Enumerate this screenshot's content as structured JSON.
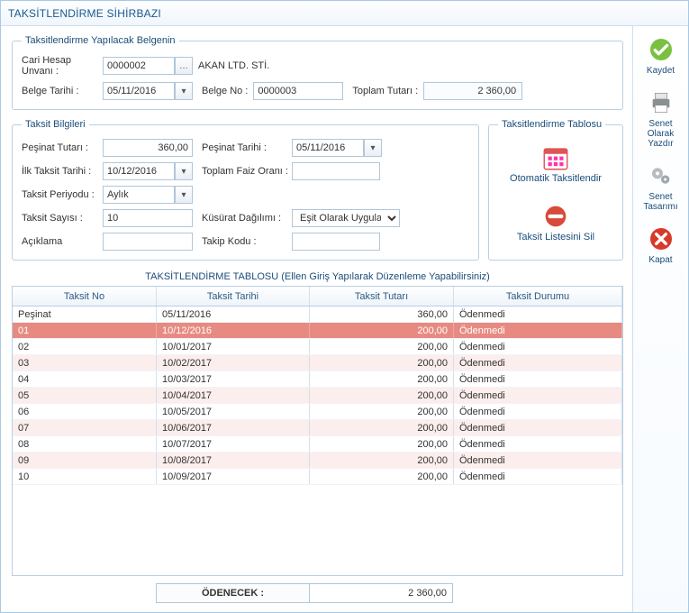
{
  "window_title": "TAKSİTLENDİRME SİHİRBAZI",
  "doc": {
    "legend": "Taksitlendirme Yapılacak Belgenin",
    "cari_label": "Cari Hesap Unvanı :",
    "cari_value": "0000002",
    "cari_name": "AKAN LTD. STİ.",
    "belge_tarihi_label": "Belge Tarihi :",
    "belge_tarihi_value": "05/11/2016",
    "belge_no_label": "Belge No :",
    "belge_no_value": "0000003",
    "toplam_label": "Toplam Tutarı :",
    "toplam_value": "2 360,00"
  },
  "taksit": {
    "legend": "Taksit Bilgileri",
    "pesinat_tutar_label": "Peşinat Tutarı :",
    "pesinat_tutar_value": "360,00",
    "pesinat_tarihi_label": "Peşinat Tarihi :",
    "pesinat_tarihi_value": "05/11/2016",
    "ilk_taksit_tarihi_label": "İlk Taksit Tarihi :",
    "ilk_taksit_tarihi_value": "10/12/2016",
    "faiz_label": "Toplam Faiz Oranı :",
    "faiz_value": "",
    "periyod_label": "Taksit Periyodu :",
    "periyod_value": "Aylık",
    "sayi_label": "Taksit Sayısı :",
    "sayi_value": "10",
    "kusurat_label": "Küsürat Dağılımı :",
    "kusurat_value": "Eşit Olarak Uygula",
    "aciklama_label": "Açıklama",
    "aciklama_value": "",
    "takip_label": "Takip Kodu :",
    "takip_value": ""
  },
  "actions": {
    "legend": "Taksitlendirme Tablosu",
    "otomatik": "Otomatik Taksitlendir",
    "sil": "Taksit Listesini Sil"
  },
  "grid": {
    "caption": "TAKSİTLENDİRME TABLOSU (Ellen Giriş Yapılarak Düzenleme Yapabilirsiniz)",
    "cols": [
      "Taksit No",
      "Taksit Tarihi",
      "Taksit Tutarı",
      "Taksit Durumu"
    ],
    "rows": [
      {
        "no": "Peşinat",
        "date": "05/11/2016",
        "amount": "360,00",
        "status": "Ödenmedi",
        "style": ""
      },
      {
        "no": "01",
        "date": "10/12/2016",
        "amount": "200,00",
        "status": "Ödenmedi",
        "style": "sel"
      },
      {
        "no": "02",
        "date": "10/01/2017",
        "amount": "200,00",
        "status": "Ödenmedi",
        "style": ""
      },
      {
        "no": "03",
        "date": "10/02/2017",
        "amount": "200,00",
        "status": "Ödenmedi",
        "style": "alt"
      },
      {
        "no": "04",
        "date": "10/03/2017",
        "amount": "200,00",
        "status": "Ödenmedi",
        "style": ""
      },
      {
        "no": "05",
        "date": "10/04/2017",
        "amount": "200,00",
        "status": "Ödenmedi",
        "style": "alt"
      },
      {
        "no": "06",
        "date": "10/05/2017",
        "amount": "200,00",
        "status": "Ödenmedi",
        "style": ""
      },
      {
        "no": "07",
        "date": "10/06/2017",
        "amount": "200,00",
        "status": "Ödenmedi",
        "style": "alt"
      },
      {
        "no": "08",
        "date": "10/07/2017",
        "amount": "200,00",
        "status": "Ödenmedi",
        "style": ""
      },
      {
        "no": "09",
        "date": "10/08/2017",
        "amount": "200,00",
        "status": "Ödenmedi",
        "style": "alt"
      },
      {
        "no": "10",
        "date": "10/09/2017",
        "amount": "200,00",
        "status": "Ödenmedi",
        "style": ""
      }
    ],
    "footer_label": "ÖDENECEK :",
    "footer_value": "2 360,00"
  },
  "sidebar": {
    "save": "Kaydet",
    "print": "Senet Olarak Yazdır",
    "design": "Senet Tasarımı",
    "close": "Kapat"
  }
}
